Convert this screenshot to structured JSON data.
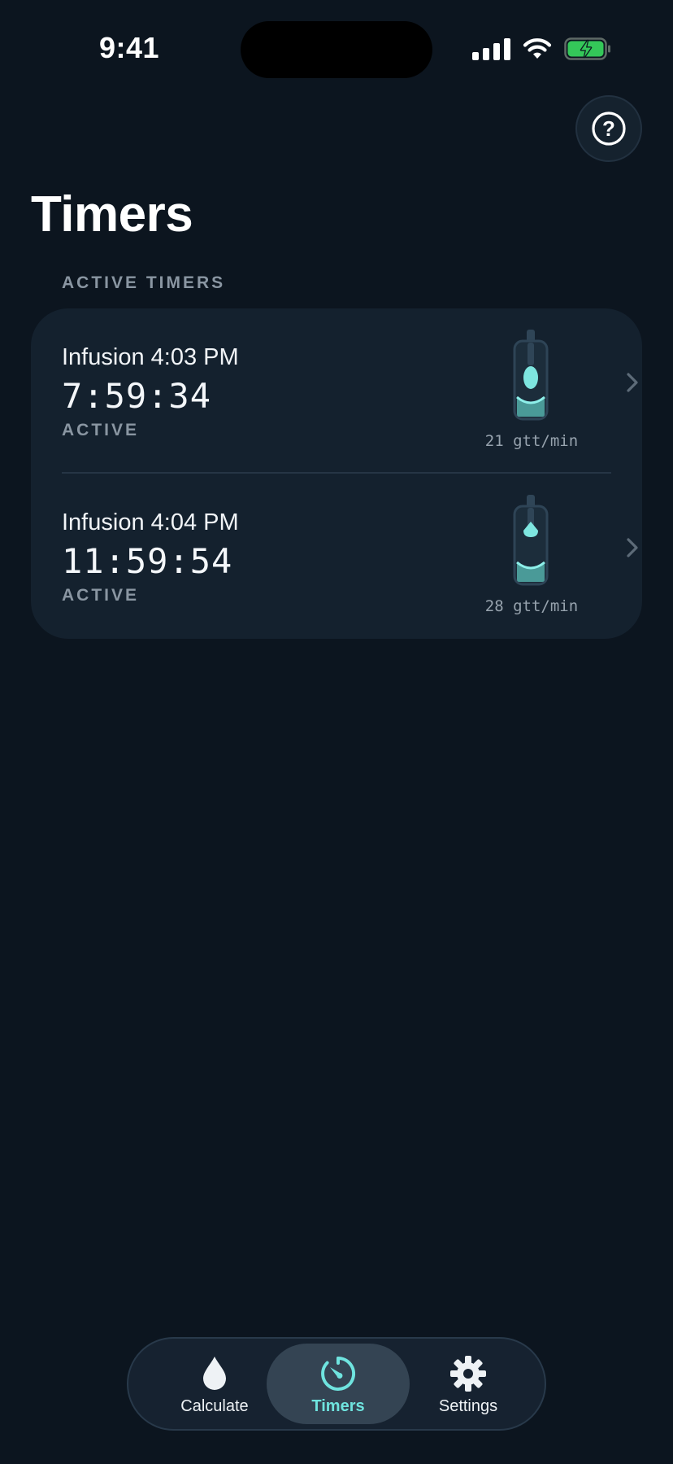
{
  "status_bar": {
    "time": "9:41"
  },
  "header": {
    "title": "Timers",
    "help_symbol": "?"
  },
  "section": {
    "title": "ACTIVE TIMERS"
  },
  "timers": [
    {
      "name": "Infusion 4:03 PM",
      "countdown": "7:59:34",
      "status": "ACTIVE",
      "rate": "21 gtt/min",
      "drip_phase": "full-drop"
    },
    {
      "name": "Infusion 4:04 PM",
      "countdown": "11:59:54",
      "status": "ACTIVE",
      "rate": "28 gtt/min",
      "drip_phase": "forming-drop"
    }
  ],
  "tab_bar": {
    "tabs": [
      {
        "label": "Calculate",
        "icon": "water-drop-icon",
        "selected": false
      },
      {
        "label": "Timers",
        "icon": "timer-icon",
        "selected": true
      },
      {
        "label": "Settings",
        "icon": "gear-icon",
        "selected": false
      }
    ]
  },
  "colors": {
    "background": "#0c151f",
    "card": "#14212e",
    "accent": "#6fe4df",
    "secondary_text": "#8a96a2",
    "battery": "#34c759"
  }
}
